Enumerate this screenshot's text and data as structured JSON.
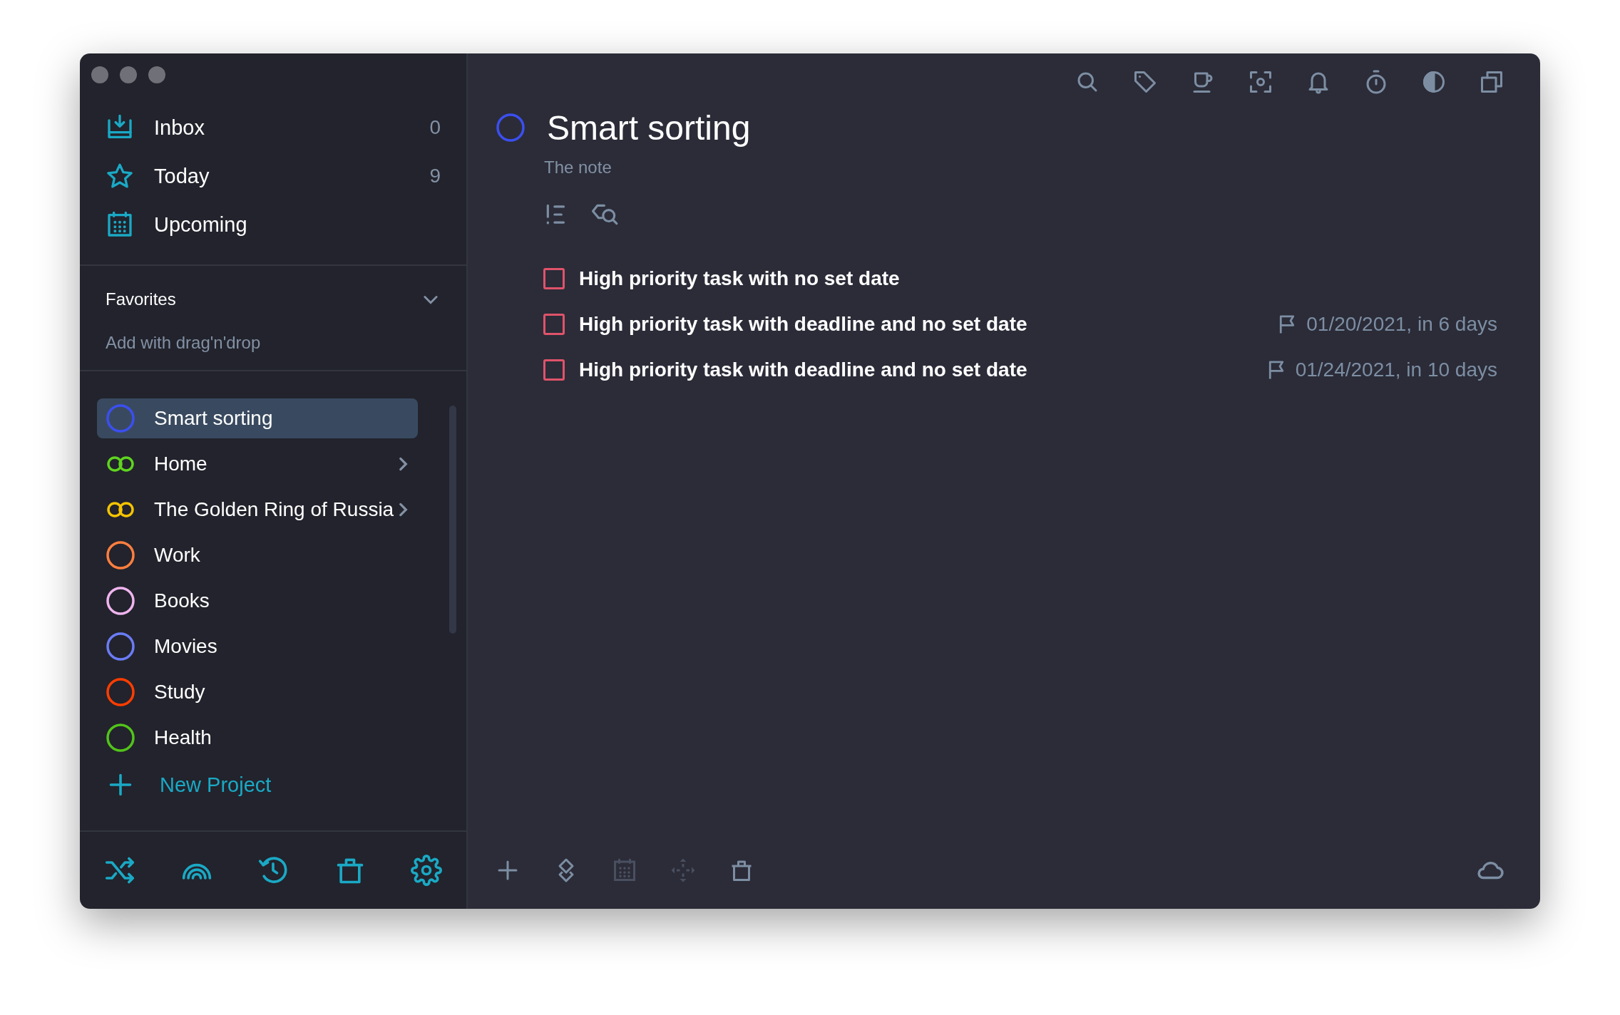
{
  "sidebar": {
    "nav": [
      {
        "kind": "inbox",
        "label": "Inbox",
        "count": "0",
        "selected": false
      },
      {
        "kind": "today",
        "label": "Today",
        "count": "9",
        "selected": false
      },
      {
        "kind": "upcoming",
        "label": "Upcoming",
        "selected": false
      }
    ],
    "favorites": {
      "title": "Favorites",
      "expanded": true,
      "hint": "Add with drag'n'drop"
    },
    "projects": [
      {
        "kind": "single",
        "label": "Smart sorting",
        "color": "#3b4ff0",
        "has_children": false,
        "selected": true
      },
      {
        "kind": "group",
        "label": "Home",
        "color": "#5fd41f",
        "has_children": true,
        "selected": false
      },
      {
        "kind": "group",
        "label": "The Golden Ring of Russia",
        "color": "#f5c400",
        "has_children": true,
        "selected": false
      },
      {
        "kind": "single",
        "label": "Work",
        "color": "#ff7f3f",
        "has_children": false,
        "selected": false
      },
      {
        "kind": "single",
        "label": "Books",
        "color": "#f0b4ef",
        "has_children": false,
        "selected": false
      },
      {
        "kind": "single",
        "label": "Movies",
        "color": "#6b7cf5",
        "has_children": false,
        "selected": false
      },
      {
        "kind": "single",
        "label": "Study",
        "color": "#ff3d00",
        "has_children": false,
        "selected": false
      },
      {
        "kind": "single",
        "label": "Health",
        "color": "#52c41a",
        "has_children": false,
        "selected": false
      }
    ],
    "new_project": "New Project"
  },
  "main": {
    "title": "Smart sorting",
    "note": "The note",
    "tasks": [
      {
        "title": "High priority task with no set date",
        "color": "#e0536a",
        "checked": false
      },
      {
        "title": "High priority task with deadline and no set date",
        "color": "#e0536a",
        "checked": false,
        "deadline": "01/20/2021, in 6 days"
      },
      {
        "title": "High priority task with deadline and no set date",
        "color": "#e0536a",
        "checked": false,
        "deadline": "01/24/2021, in 10 days"
      }
    ],
    "footer_buttons": [
      {
        "kind": "add",
        "disabled": false
      },
      {
        "kind": "layers",
        "disabled": false
      },
      {
        "kind": "calendar",
        "disabled": true
      },
      {
        "kind": "move",
        "disabled": true
      },
      {
        "kind": "trash",
        "disabled": false
      }
    ]
  }
}
